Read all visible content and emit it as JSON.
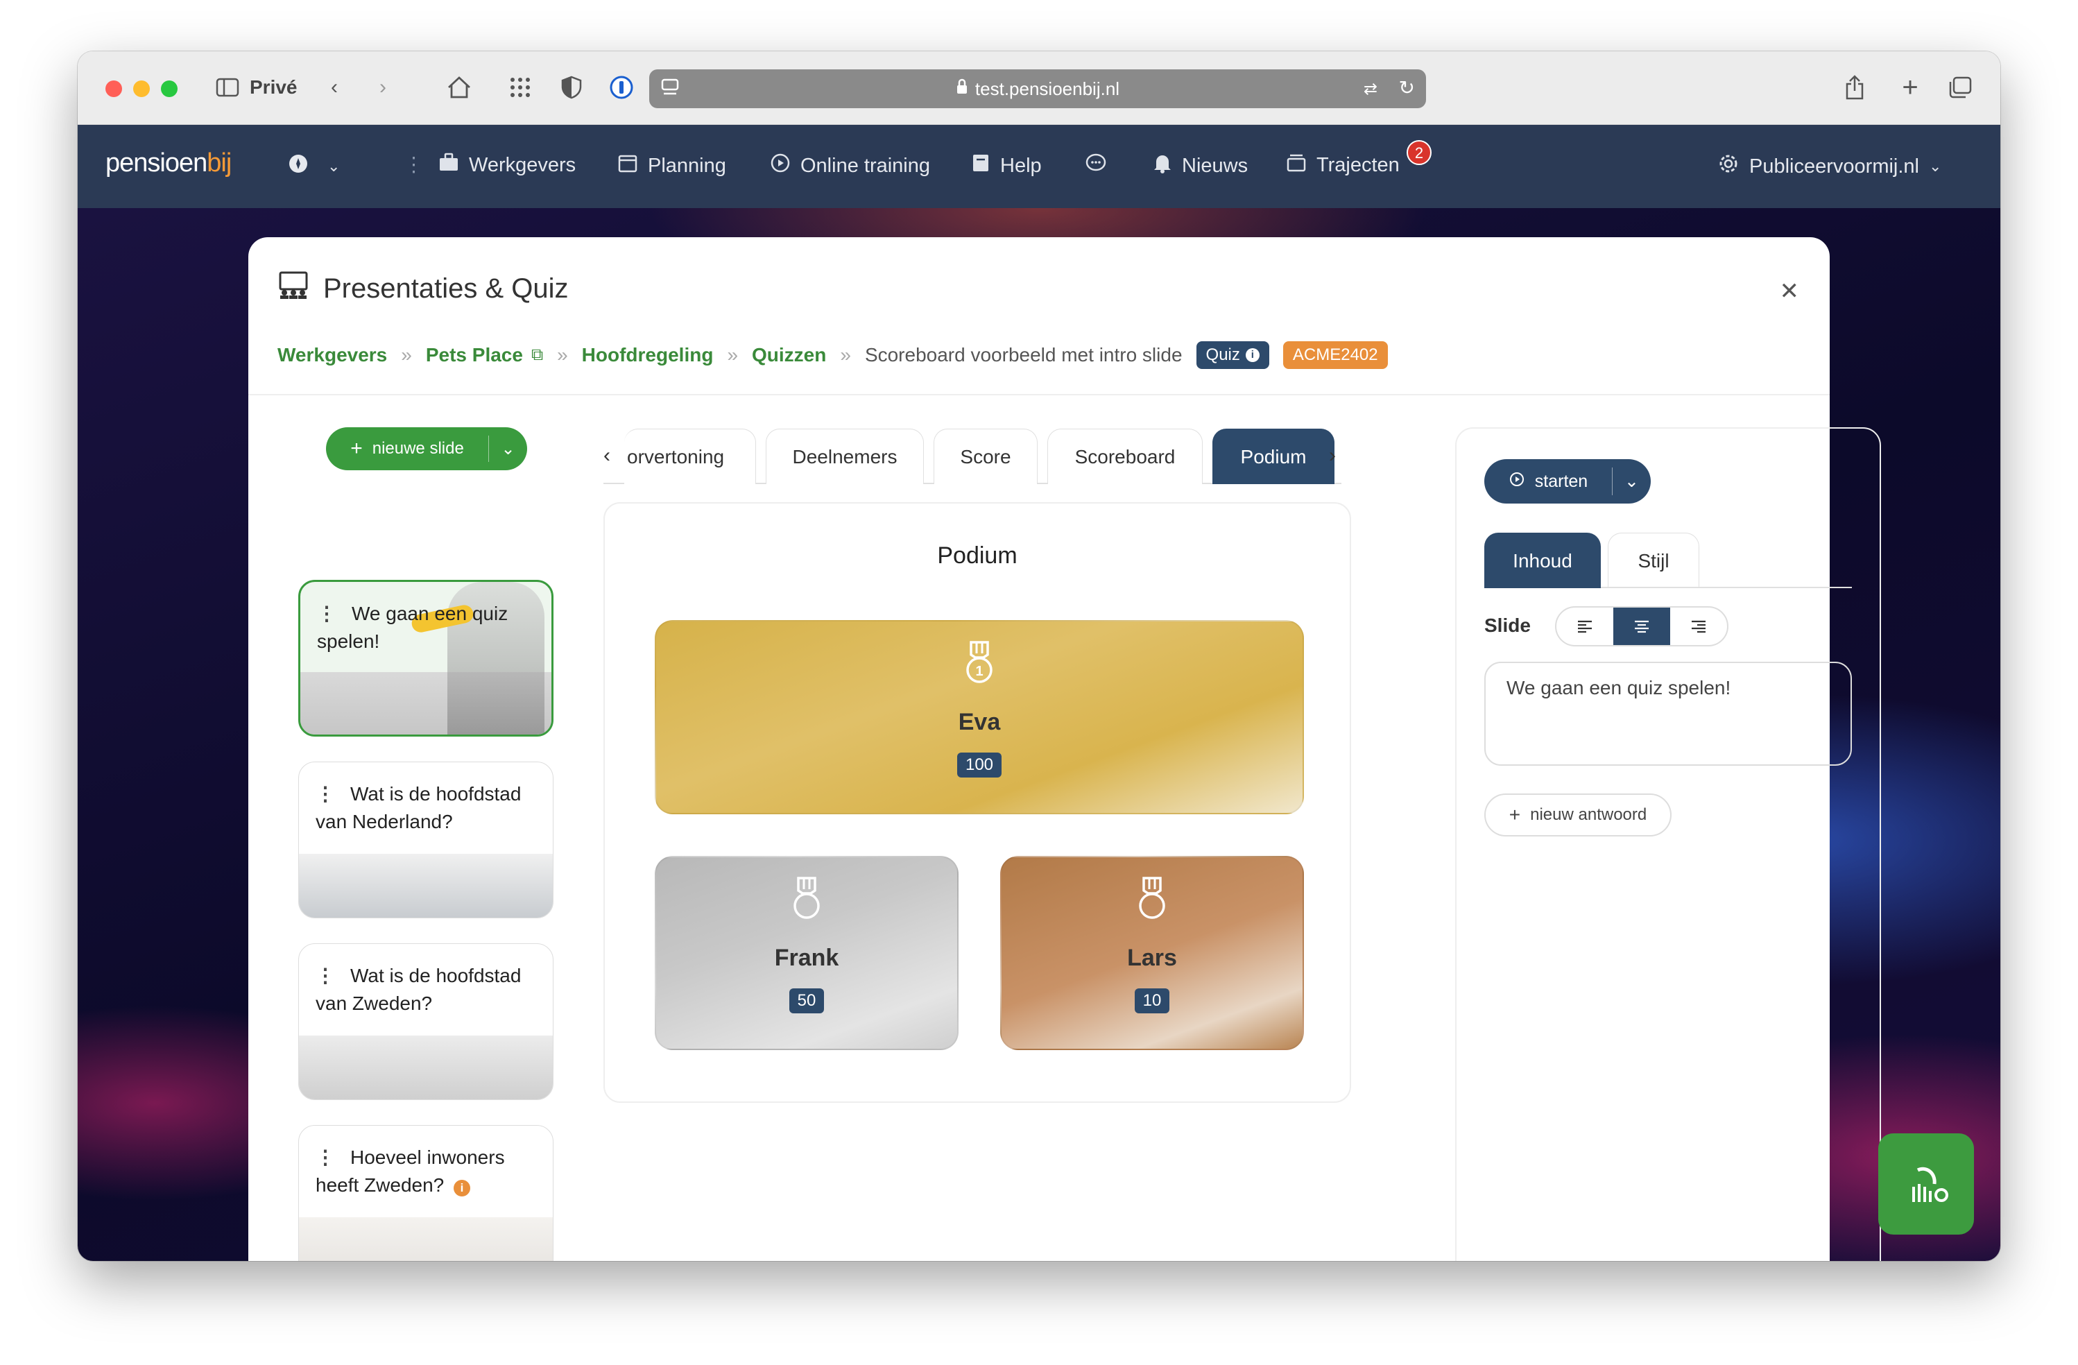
{
  "browser": {
    "mode_label": "Privé",
    "url": "test.pensioenbij.nl"
  },
  "app": {
    "logo_main": "pensioen",
    "logo_accent": "bij",
    "nav": {
      "werkgevers": "Werkgevers",
      "planning": "Planning",
      "online_training": "Online training",
      "help": "Help",
      "nieuws": "Nieuws",
      "trajecten": "Trajecten",
      "trajecten_badge": "2",
      "account": "Publiceervoormij.nl"
    }
  },
  "modal": {
    "title": "Presentaties & Quiz",
    "breadcrumbs": {
      "werkgevers": "Werkgevers",
      "pets_place": "Pets Place",
      "hoofdregeling": "Hoofdregeling",
      "quizzen": "Quizzen",
      "current": "Scoreboard voorbeeld met intro slide",
      "tag_quiz": "Quiz",
      "tag_code": "ACME2402"
    },
    "new_slide_label": "nieuwe slide",
    "slides": [
      {
        "title": "We gaan een quiz spelen!"
      },
      {
        "title": "Wat is de hoofdstad van Nederland?"
      },
      {
        "title": "Wat is de hoofdstad van Zweden?"
      },
      {
        "title": "Hoeveel inwoners heeft Zweden?"
      }
    ],
    "tabs": [
      "orvertoning",
      "Deelnemers",
      "Score",
      "Scoreboard",
      "Podium"
    ],
    "podium": {
      "title": "Podium",
      "first": {
        "name": "Eva",
        "score": "100"
      },
      "second": {
        "name": "Frank",
        "score": "50"
      },
      "third": {
        "name": "Lars",
        "score": "10"
      }
    },
    "right": {
      "start_label": "starten",
      "tab_inhoud": "Inhoud",
      "tab_stijl": "Stijl",
      "slide_label": "Slide",
      "slide_text": "We gaan een quiz spelen!",
      "new_answer_label": "nieuw antwoord"
    }
  },
  "colors": {
    "nav_bg": "#2b3a55",
    "primary_green": "#3a9b3e",
    "primary_blue": "#2d4a6b",
    "orange_tag": "#e98f3a",
    "badge_red": "#d9342b"
  }
}
